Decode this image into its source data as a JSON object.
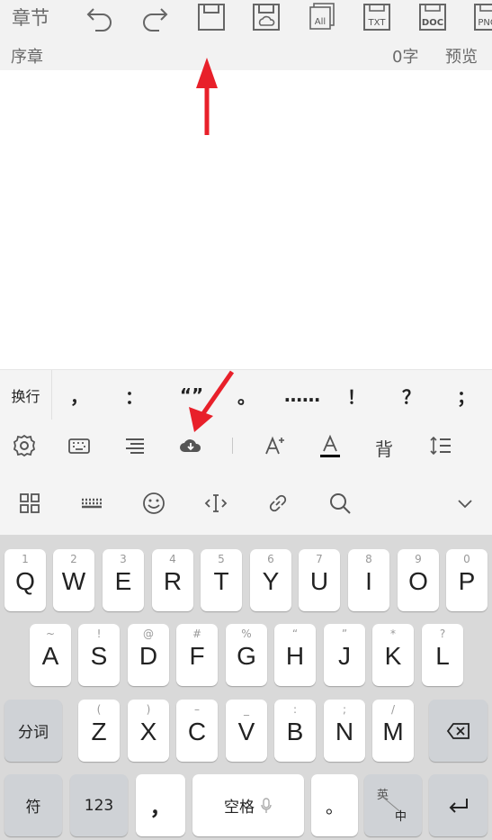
{
  "toolbar": {
    "chapter_label": "章节",
    "sub_left": "序章",
    "char_count": "0字",
    "preview_label": "预览",
    "icons": [
      "undo-icon",
      "redo-icon",
      "save-icon",
      "save-cloud-icon",
      "save-all-icon",
      "export-txt-icon",
      "export-doc-icon",
      "export-png-icon"
    ],
    "txt_label": "TXT",
    "doc_label": "DOC",
    "all_label": "All",
    "png_label": "PNG"
  },
  "punctuation": {
    "wrap_label": "换行",
    "keys": [
      "，",
      "：",
      "“”",
      "。",
      "……",
      "！",
      "？",
      "；"
    ]
  },
  "tools": {
    "bg_label": "背",
    "row1": [
      "settings-icon",
      "keyboard-icon",
      "align-icon",
      "cloud-download-icon",
      "font-size-icon",
      "font-color-icon",
      "background-color-icon",
      "line-spacing-icon"
    ],
    "row2": [
      "grid-icon",
      "keyboard-layout-icon",
      "emoji-icon",
      "cursor-icon",
      "link-icon",
      "search-icon",
      "chevron-down-icon"
    ]
  },
  "keyboard": {
    "row1": [
      {
        "letter": "Q",
        "num": "1"
      },
      {
        "letter": "W",
        "num": "2"
      },
      {
        "letter": "E",
        "num": "3"
      },
      {
        "letter": "R",
        "num": "4"
      },
      {
        "letter": "T",
        "num": "5"
      },
      {
        "letter": "Y",
        "num": "6"
      },
      {
        "letter": "U",
        "num": "7"
      },
      {
        "letter": "I",
        "num": "8"
      },
      {
        "letter": "O",
        "num": "9"
      },
      {
        "letter": "P",
        "num": "0"
      }
    ],
    "row2": [
      {
        "letter": "A",
        "num": "~"
      },
      {
        "letter": "S",
        "num": "!"
      },
      {
        "letter": "D",
        "num": "@"
      },
      {
        "letter": "F",
        "num": "#"
      },
      {
        "letter": "G",
        "num": "%"
      },
      {
        "letter": "H",
        "num": "“"
      },
      {
        "letter": "J",
        "num": "”"
      },
      {
        "letter": "K",
        "num": "*"
      },
      {
        "letter": "L",
        "num": "?"
      }
    ],
    "row3": [
      {
        "letter": "Z",
        "num": "("
      },
      {
        "letter": "X",
        "num": ")"
      },
      {
        "letter": "C",
        "num": "–"
      },
      {
        "letter": "V",
        "num": "_"
      },
      {
        "letter": "B",
        "num": ":"
      },
      {
        "letter": "N",
        "num": ";"
      },
      {
        "letter": "M",
        "num": "/"
      }
    ],
    "fenci_label": "分词",
    "fu_label": "符",
    "num_label": "123",
    "comma_label": "，",
    "space_label": "空格",
    "period_label": "。",
    "lang_en": "英",
    "lang_zh": "中"
  },
  "colors": {
    "accent_red": "#e8202a",
    "toolbar_bg": "#f2f2f2",
    "keyboard_bg": "#d9d9d9"
  }
}
